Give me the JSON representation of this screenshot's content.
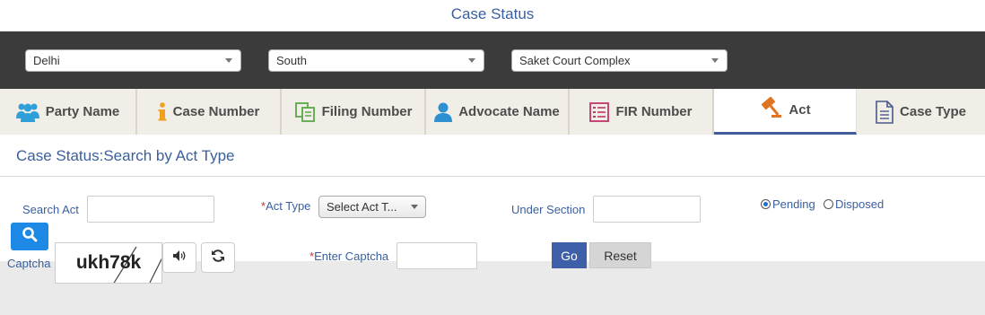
{
  "page": {
    "title": "Case Status"
  },
  "selectors": {
    "state": "Delhi",
    "district": "South",
    "court_complex": "Saket Court Complex"
  },
  "tabs": [
    {
      "label": "Party Name",
      "icon": "people-icon",
      "active": false
    },
    {
      "label": "Case Number",
      "icon": "info-icon",
      "active": false
    },
    {
      "label": "Filing Number",
      "icon": "copy-icon",
      "active": false
    },
    {
      "label": "Advocate Name",
      "icon": "person-icon",
      "active": false
    },
    {
      "label": "FIR Number",
      "icon": "list-icon",
      "active": false
    },
    {
      "label": "Act",
      "icon": "gavel-icon",
      "active": true
    },
    {
      "label": "Case Type",
      "icon": "document-icon",
      "active": false
    }
  ],
  "section": {
    "heading": "Case Status:Search by Act Type"
  },
  "form": {
    "search_act_label": "Search Act",
    "search_act_value": "",
    "act_type_required": "*",
    "act_type_label": "Act Type",
    "act_type_selected": "Select Act T...",
    "under_section_label": "Under Section",
    "under_section_value": "",
    "pending_label": "Pending",
    "disposed_label": "Disposed",
    "status_selected": "Pending",
    "captcha_label": "Captcha",
    "captcha_text": "ukh78k",
    "enter_captcha_required": "*",
    "enter_captcha_label": "Enter Captcha",
    "enter_captcha_value": "",
    "go_label": "Go",
    "reset_label": "Reset"
  },
  "colors": {
    "accent": "#3a5f9e",
    "dark_bar": "#3b3b3b",
    "tab_bg": "#f1ede7",
    "search_button": "#1e88e5",
    "go_button": "#3f5fa8"
  }
}
